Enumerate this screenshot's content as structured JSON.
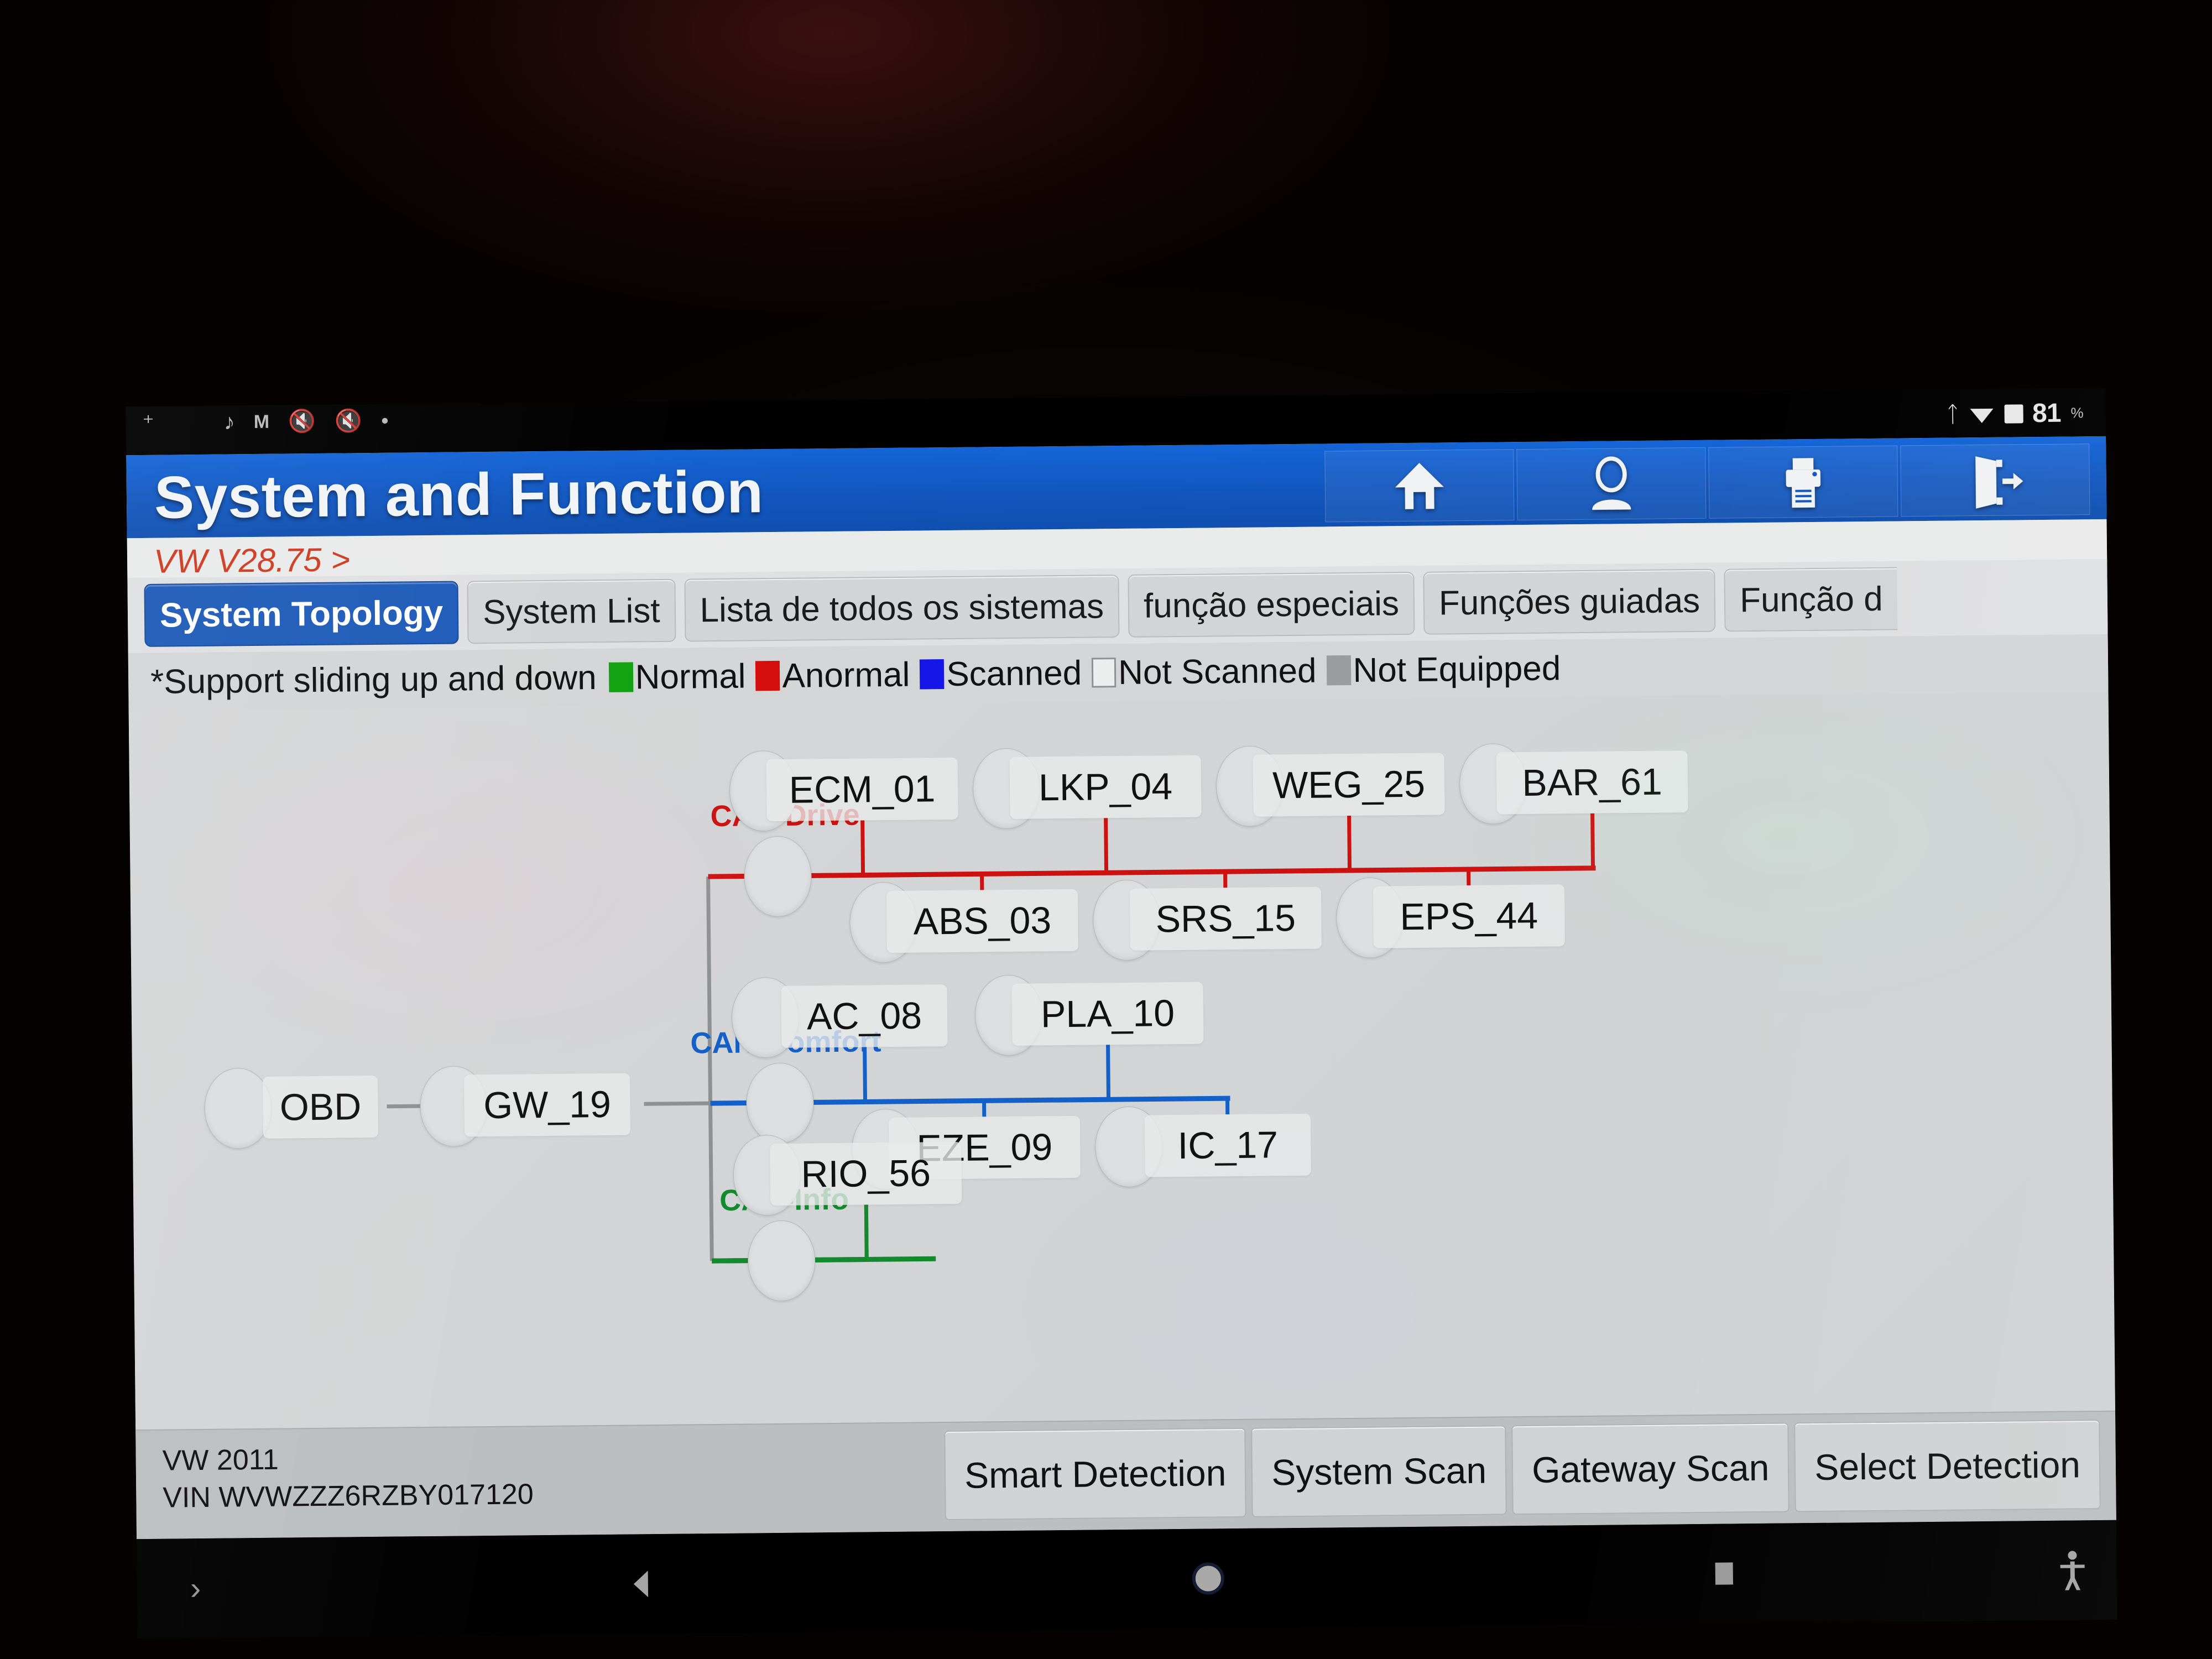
{
  "status_bar": {
    "left_icons": [
      "notification-caret",
      "music-note-icon",
      "gmail-icon",
      "mute-icon",
      "dnd-icon",
      "dot-icon"
    ],
    "bluetooth_icon": "bluetooth-icon",
    "wifi_icon": "wifi-icon",
    "battery_icon": "battery-icon",
    "battery_level": "81",
    "battery_unit": "%"
  },
  "header": {
    "title": "System and Function",
    "toolbar": [
      {
        "name": "home-icon",
        "label": "Home"
      },
      {
        "name": "user-icon",
        "label": "User"
      },
      {
        "name": "printer-icon",
        "label": "Print"
      },
      {
        "name": "exit-icon",
        "label": "Exit"
      }
    ]
  },
  "breadcrumb": {
    "text": "VW V28.75 >"
  },
  "tabs": [
    {
      "label": "System Topology",
      "active": true
    },
    {
      "label": "System List",
      "active": false
    },
    {
      "label": "Lista de todos os sistemas",
      "active": false
    },
    {
      "label": "função especiais",
      "active": false
    },
    {
      "label": "Funções guiadas",
      "active": false
    },
    {
      "label": "Função d",
      "active": false,
      "clipped": true
    }
  ],
  "legend": {
    "note": "*Support sliding up and down",
    "items": [
      {
        "label": "Normal",
        "color": "#11a111"
      },
      {
        "label": "Anormal",
        "color": "#d60d0d"
      },
      {
        "label": "Scanned",
        "color": "#1616e8"
      },
      {
        "label": "Not Scanned",
        "color": "#eceded",
        "outline": true
      },
      {
        "label": "Not Equipped",
        "color": "#9a9d9e"
      }
    ]
  },
  "topology": {
    "entry_nodes": [
      {
        "id": "OBD",
        "label": "OBD",
        "status": "not-scanned"
      },
      {
        "id": "GW_19",
        "label": "GW_19",
        "status": "not-scanned"
      }
    ],
    "buses": [
      {
        "id": "can-drive",
        "label": "CAN-Drive",
        "color": "#cc1111",
        "top_nodes": [
          "ECM_01",
          "LKP_04",
          "WEG_25",
          "BAR_61"
        ],
        "bottom_nodes": [
          "ABS_03",
          "SRS_15",
          "EPS_44"
        ]
      },
      {
        "id": "can-comfort",
        "label": "CAN-Comfort",
        "color": "#1360c8",
        "top_nodes": [
          "AC_08",
          "PLA_10"
        ],
        "bottom_nodes": [
          "EZE_09",
          "IC_17"
        ]
      },
      {
        "id": "can-info",
        "label": "CAN-Info",
        "color": "#138a2e",
        "top_nodes": [
          "RIO_56"
        ],
        "bottom_nodes": []
      }
    ],
    "node_status_default": "not-scanned"
  },
  "vehicle": {
    "make_year": "VW  2011",
    "vin_label": "VIN",
    "vin": "WVWZZZ6RZBY017120"
  },
  "actions": [
    {
      "label": "Smart Detection"
    },
    {
      "label": "System Scan"
    },
    {
      "label": "Gateway Scan"
    },
    {
      "label": "Select Detection"
    }
  ],
  "nav_bar": {
    "items": [
      {
        "name": "expand-chevron-icon",
        "glyph": "›"
      },
      {
        "name": "back-icon",
        "glyph": "◀"
      },
      {
        "name": "home-circle-icon",
        "glyph": "●"
      },
      {
        "name": "recents-square-icon",
        "glyph": "■"
      },
      {
        "name": "accessibility-icon",
        "glyph": "ᾝ1"
      }
    ]
  },
  "colors": {
    "accent_blue": "#1565d8",
    "breadcrumb_red": "#cf3b22",
    "panel_gray": "#d3d5d6",
    "bottom_gray": "#bcbfc0"
  }
}
